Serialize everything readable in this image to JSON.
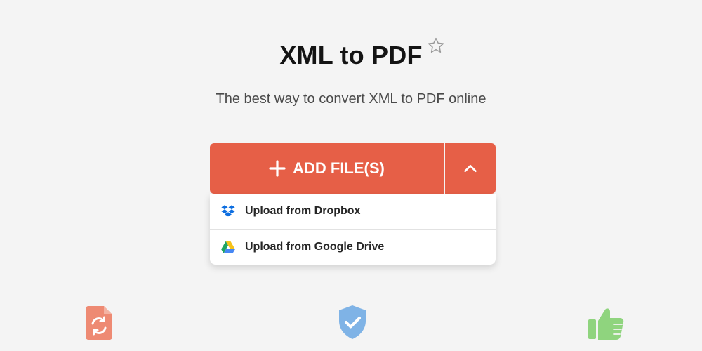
{
  "header": {
    "title": "XML to PDF",
    "subtitle": "The best way to convert XML to PDF online",
    "favorite_icon": "star-outline-icon"
  },
  "upload": {
    "add_label": "ADD FILE(S)",
    "toggle_icon": "chevron-up-icon",
    "accent_color": "#e65f47",
    "options": [
      {
        "label": "Upload from Dropbox",
        "icon": "dropbox-icon"
      },
      {
        "label": "Upload from Google Drive",
        "icon": "google-drive-icon"
      }
    ]
  },
  "features": [
    {
      "icon": "file-convert-icon",
      "color": "#ee8a73"
    },
    {
      "icon": "shield-check-icon",
      "color": "#7fb3e6"
    },
    {
      "icon": "thumbs-up-icon",
      "color": "#8fd47e"
    }
  ]
}
